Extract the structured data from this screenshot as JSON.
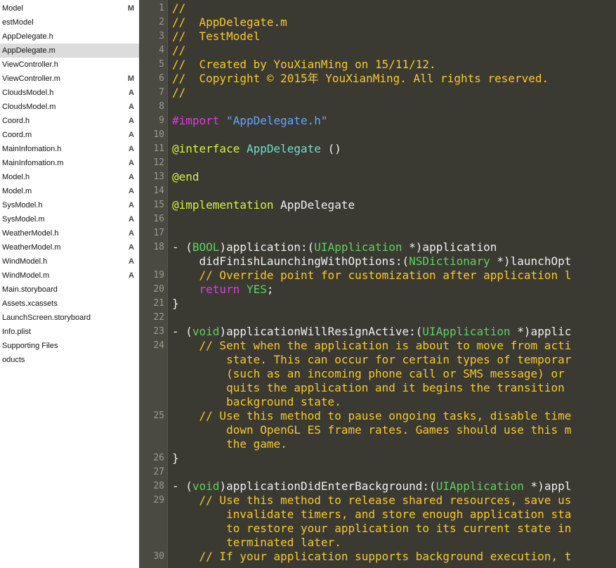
{
  "navigator": {
    "items": [
      {
        "label": "Model",
        "badge": "M",
        "selected": false
      },
      {
        "label": "estModel",
        "badge": "",
        "selected": false
      },
      {
        "label": "AppDelegate.h",
        "badge": "",
        "selected": false
      },
      {
        "label": "AppDelegate.m",
        "badge": "",
        "selected": true
      },
      {
        "label": "ViewController.h",
        "badge": "",
        "selected": false
      },
      {
        "label": "ViewController.m",
        "badge": "M",
        "selected": false
      },
      {
        "label": "CloudsModel.h",
        "badge": "A",
        "selected": false
      },
      {
        "label": "CloudsModel.m",
        "badge": "A",
        "selected": false
      },
      {
        "label": "Coord.h",
        "badge": "A",
        "selected": false
      },
      {
        "label": "Coord.m",
        "badge": "A",
        "selected": false
      },
      {
        "label": "MainInfomation.h",
        "badge": "A",
        "selected": false
      },
      {
        "label": "MainInfomation.m",
        "badge": "A",
        "selected": false
      },
      {
        "label": "Model.h",
        "badge": "A",
        "selected": false
      },
      {
        "label": "Model.m",
        "badge": "A",
        "selected": false
      },
      {
        "label": "SysModel.h",
        "badge": "A",
        "selected": false
      },
      {
        "label": "SysModel.m",
        "badge": "A",
        "selected": false
      },
      {
        "label": "WeatherModel.h",
        "badge": "A",
        "selected": false
      },
      {
        "label": "WeatherModel.m",
        "badge": "A",
        "selected": false
      },
      {
        "label": "WindModel.h",
        "badge": "A",
        "selected": false
      },
      {
        "label": "WindModel.m",
        "badge": "A",
        "selected": false
      },
      {
        "label": "Main.storyboard",
        "badge": "",
        "selected": false
      },
      {
        "label": "Assets.xcassets",
        "badge": "",
        "selected": false
      },
      {
        "label": "LaunchScreen.storyboard",
        "badge": "",
        "selected": false
      },
      {
        "label": "Info.plist",
        "badge": "",
        "selected": false
      },
      {
        "label": "Supporting Files",
        "badge": "",
        "selected": false
      },
      {
        "label": "oducts",
        "badge": "",
        "selected": false
      }
    ]
  },
  "editor": {
    "line_numbers": [
      "1",
      "2",
      "3",
      "4",
      "5",
      "6",
      "7",
      "8",
      "9",
      "10",
      "11",
      "12",
      "13",
      "14",
      "15",
      "16",
      "17",
      "18",
      "19",
      "20",
      "21",
      "22",
      "23",
      "24",
      "25",
      "26",
      "27",
      "28",
      "29",
      "30"
    ],
    "rows": [
      {
        "ln": "1",
        "segments": [
          {
            "t": "//",
            "c": "com"
          }
        ]
      },
      {
        "ln": "2",
        "segments": [
          {
            "t": "//  AppDelegate.m",
            "c": "com"
          }
        ]
      },
      {
        "ln": "3",
        "segments": [
          {
            "t": "//  TestModel",
            "c": "com"
          }
        ]
      },
      {
        "ln": "4",
        "segments": [
          {
            "t": "//",
            "c": "com"
          }
        ]
      },
      {
        "ln": "5",
        "segments": [
          {
            "t": "//  Created by YouXianMing on 15/11/12.",
            "c": "com"
          }
        ]
      },
      {
        "ln": "6",
        "segments": [
          {
            "t": "//  Copyright © 2015年 YouXianMing. All rights reserved.",
            "c": "com"
          }
        ]
      },
      {
        "ln": "7",
        "segments": [
          {
            "t": "//",
            "c": "com"
          }
        ]
      },
      {
        "ln": "8",
        "segments": []
      },
      {
        "ln": "9",
        "segments": [
          {
            "t": "#import ",
            "c": "kw"
          },
          {
            "t": "\"AppDelegate.h\"",
            "c": "str"
          }
        ]
      },
      {
        "ln": "10",
        "segments": []
      },
      {
        "ln": "11",
        "segments": [
          {
            "t": "@interface ",
            "c": "at"
          },
          {
            "t": "AppDelegate",
            "c": "cls"
          },
          {
            "t": " ()",
            "c": "plain"
          }
        ]
      },
      {
        "ln": "12",
        "segments": []
      },
      {
        "ln": "13",
        "segments": [
          {
            "t": "@end",
            "c": "at"
          }
        ]
      },
      {
        "ln": "14",
        "segments": []
      },
      {
        "ln": "15",
        "segments": [
          {
            "t": "@implementation ",
            "c": "at"
          },
          {
            "t": "AppDelegate",
            "c": "plain"
          }
        ]
      },
      {
        "ln": "16",
        "segments": []
      },
      {
        "ln": "17",
        "segments": []
      },
      {
        "ln": "18",
        "segments": [
          {
            "t": "- (",
            "c": "plain"
          },
          {
            "t": "BOOL",
            "c": "type"
          },
          {
            "t": ")application:(",
            "c": "plain"
          },
          {
            "t": "UIApplication",
            "c": "type"
          },
          {
            "t": " *)application",
            "c": "plain"
          }
        ]
      },
      {
        "ln": "",
        "segments": [
          {
            "t": "    didFinishLaunchingWithOptions:(",
            "c": "plain"
          },
          {
            "t": "NSDictionary",
            "c": "type"
          },
          {
            "t": " *)launchOpt",
            "c": "plain"
          }
        ]
      },
      {
        "ln": "19",
        "segments": [
          {
            "t": "    // Override point for customization after application l",
            "c": "com"
          }
        ]
      },
      {
        "ln": "20",
        "segments": [
          {
            "t": "    ",
            "c": "plain"
          },
          {
            "t": "return",
            "c": "kw"
          },
          {
            "t": " ",
            "c": "plain"
          },
          {
            "t": "YES",
            "c": "type"
          },
          {
            "t": ";",
            "c": "plain"
          }
        ]
      },
      {
        "ln": "21",
        "segments": [
          {
            "t": "}",
            "c": "plain"
          }
        ]
      },
      {
        "ln": "22",
        "segments": []
      },
      {
        "ln": "23",
        "segments": [
          {
            "t": "- (",
            "c": "plain"
          },
          {
            "t": "void",
            "c": "type"
          },
          {
            "t": ")applicationWillResignActive:(",
            "c": "plain"
          },
          {
            "t": "UIApplication",
            "c": "type"
          },
          {
            "t": " *)applic",
            "c": "plain"
          }
        ]
      },
      {
        "ln": "24",
        "segments": [
          {
            "t": "    // Sent when the application is about to move from acti",
            "c": "com"
          }
        ]
      },
      {
        "ln": "",
        "segments": [
          {
            "t": "        state. This can occur for certain types of temporar",
            "c": "com"
          }
        ]
      },
      {
        "ln": "",
        "segments": [
          {
            "t": "        (such as an incoming phone call or SMS message) or",
            "c": "com"
          }
        ]
      },
      {
        "ln": "",
        "segments": [
          {
            "t": "        quits the application and it begins the transition",
            "c": "com"
          }
        ]
      },
      {
        "ln": "",
        "segments": [
          {
            "t": "        background state.",
            "c": "com"
          }
        ]
      },
      {
        "ln": "25",
        "segments": [
          {
            "t": "    // Use this method to pause ongoing tasks, disable time",
            "c": "com"
          }
        ]
      },
      {
        "ln": "",
        "segments": [
          {
            "t": "        down OpenGL ES frame rates. Games should use this m",
            "c": "com"
          }
        ]
      },
      {
        "ln": "",
        "segments": [
          {
            "t": "        the game.",
            "c": "com"
          }
        ]
      },
      {
        "ln": "26",
        "segments": [
          {
            "t": "}",
            "c": "plain"
          }
        ]
      },
      {
        "ln": "27",
        "segments": []
      },
      {
        "ln": "28",
        "segments": [
          {
            "t": "- (",
            "c": "plain"
          },
          {
            "t": "void",
            "c": "type"
          },
          {
            "t": ")applicationDidEnterBackground:(",
            "c": "plain"
          },
          {
            "t": "UIApplication",
            "c": "type"
          },
          {
            "t": " *)appl",
            "c": "plain"
          }
        ]
      },
      {
        "ln": "29",
        "segments": [
          {
            "t": "    // Use this method to release shared resources, save us",
            "c": "com"
          }
        ]
      },
      {
        "ln": "",
        "segments": [
          {
            "t": "        invalidate timers, and store enough application sta",
            "c": "com"
          }
        ]
      },
      {
        "ln": "",
        "segments": [
          {
            "t": "        to restore your application to its current state in",
            "c": "com"
          }
        ]
      },
      {
        "ln": "",
        "segments": [
          {
            "t": "        terminated later.",
            "c": "com"
          }
        ]
      },
      {
        "ln": "30",
        "segments": [
          {
            "t": "    // If your application supports background execution, t",
            "c": "com"
          }
        ]
      }
    ]
  }
}
